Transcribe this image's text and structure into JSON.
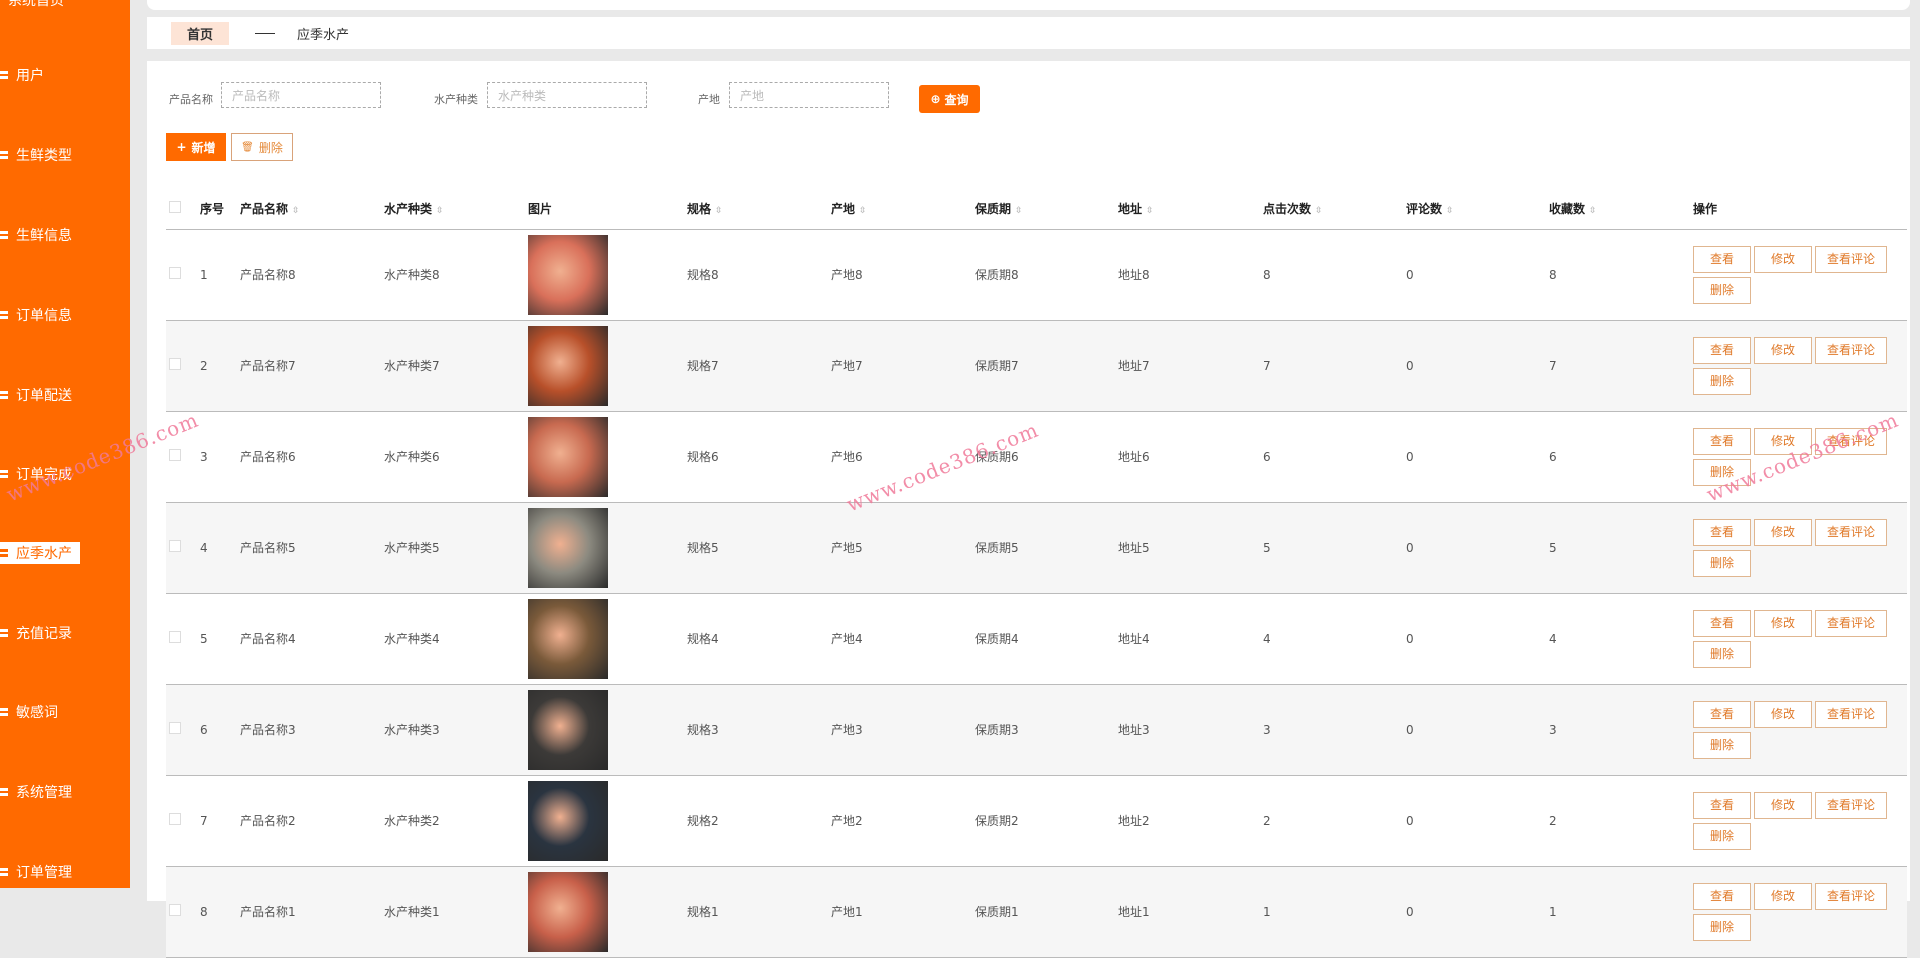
{
  "sidebar": {
    "top_partial": "系统首页",
    "items": [
      {
        "label": "用户",
        "active": false
      },
      {
        "label": "生鲜类型",
        "active": false
      },
      {
        "label": "生鲜信息",
        "active": false
      },
      {
        "label": "订单信息",
        "active": false
      },
      {
        "label": "订单配送",
        "active": false
      },
      {
        "label": "订单完成",
        "active": false
      },
      {
        "label": "应季水产",
        "active": true
      },
      {
        "label": "充值记录",
        "active": false
      },
      {
        "label": "敏感词",
        "active": false
      },
      {
        "label": "系统管理",
        "active": false
      },
      {
        "label": "订单管理",
        "active": false
      }
    ]
  },
  "breadcrumb": {
    "home": "首页",
    "current": "应季水产"
  },
  "search": {
    "fields": [
      {
        "label": "产品名称",
        "placeholder": "产品名称"
      },
      {
        "label": "水产种类",
        "placeholder": "水产种类"
      },
      {
        "label": "产地",
        "placeholder": "产地"
      }
    ],
    "query_label": "查询"
  },
  "toolbar": {
    "add_label": "新增",
    "delete_label": "删除"
  },
  "table": {
    "headers": [
      "序号",
      "产品名称",
      "水产种类",
      "图片",
      "规格",
      "产地",
      "保质期",
      "地址",
      "点击次数",
      "评论数",
      "收藏数",
      "操作"
    ],
    "actions": [
      "查看",
      "修改",
      "查看评论",
      "删除"
    ],
    "rows": [
      {
        "no": "1",
        "name": "产品名称8",
        "type": "水产种类8",
        "spec": "规格8",
        "origin": "产地8",
        "shelf": "保质期8",
        "addr": "地址8",
        "clicks": "8",
        "comments": "0",
        "favs": "8",
        "img": "#d9705a"
      },
      {
        "no": "2",
        "name": "产品名称7",
        "type": "水产种类7",
        "spec": "规格7",
        "origin": "产地7",
        "shelf": "保质期7",
        "addr": "地址7",
        "clicks": "7",
        "comments": "0",
        "favs": "7",
        "img": "#b8502a"
      },
      {
        "no": "3",
        "name": "产品名称6",
        "type": "水产种类6",
        "spec": "规格6",
        "origin": "产地6",
        "shelf": "保质期6",
        "addr": "地址6",
        "clicks": "6",
        "comments": "0",
        "favs": "6",
        "img": "#c86a50"
      },
      {
        "no": "4",
        "name": "产品名称5",
        "type": "水产种类5",
        "spec": "规格5",
        "origin": "产地5",
        "shelf": "保质期5",
        "addr": "地址5",
        "clicks": "5",
        "comments": "0",
        "favs": "5",
        "img": "#8c8a80"
      },
      {
        "no": "5",
        "name": "产品名称4",
        "type": "水产种类4",
        "spec": "规格4",
        "origin": "产地4",
        "shelf": "保质期4",
        "addr": "地址4",
        "clicks": "4",
        "comments": "0",
        "favs": "4",
        "img": "#7a5a3a"
      },
      {
        "no": "6",
        "name": "产品名称3",
        "type": "水产种类3",
        "spec": "规格3",
        "origin": "产地3",
        "shelf": "保质期3",
        "addr": "地址3",
        "clicks": "3",
        "comments": "0",
        "favs": "3",
        "img": "#3c3a38"
      },
      {
        "no": "7",
        "name": "产品名称2",
        "type": "水产种类2",
        "spec": "规格2",
        "origin": "产地2",
        "shelf": "保质期2",
        "addr": "地址2",
        "clicks": "2",
        "comments": "0",
        "favs": "2",
        "img": "#2a3440"
      },
      {
        "no": "8",
        "name": "产品名称1",
        "type": "水产种类1",
        "spec": "规格1",
        "origin": "产地1",
        "shelf": "保质期1",
        "addr": "地址1",
        "clicks": "1",
        "comments": "0",
        "favs": "1",
        "img": "#c8604a"
      }
    ]
  },
  "watermark": "www.code386.com",
  "colors": {
    "accent": "#ff6a00"
  }
}
